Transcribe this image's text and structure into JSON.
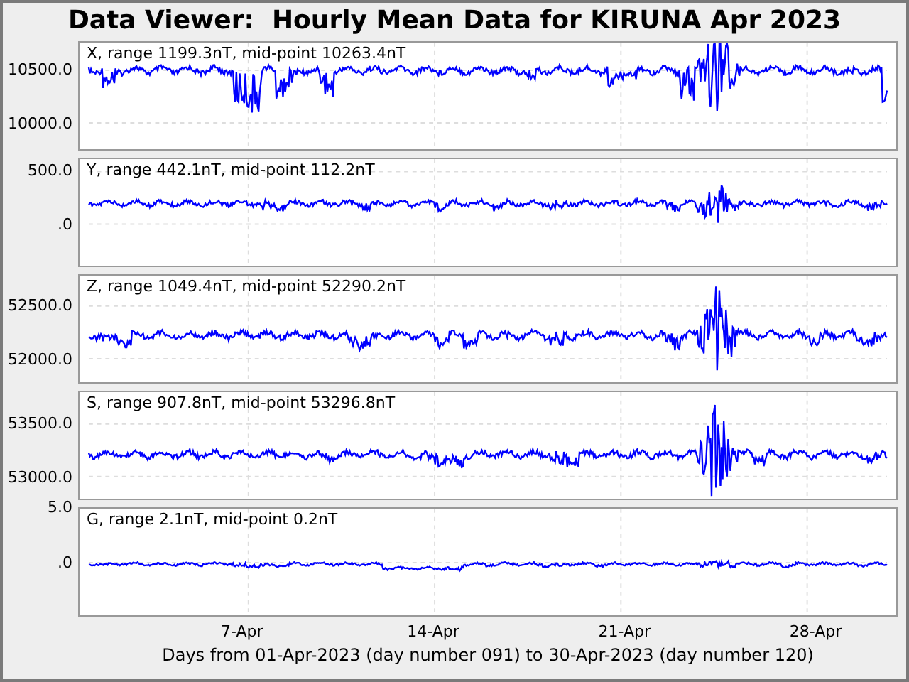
{
  "title": "Data Viewer:  Hourly Mean Data for KIRUNA Apr 2023",
  "panels": [
    {
      "label": "X, range 1199.3nT, mid-point 10263.4nT",
      "ticks": [
        "10500.0",
        "10000.0"
      ]
    },
    {
      "label": "Y, range 442.1nT, mid-point 112.2nT",
      "ticks": [
        "500.0",
        ".0"
      ]
    },
    {
      "label": "Z, range 1049.4nT, mid-point 52290.2nT",
      "ticks": [
        "52500.0",
        "52000.0"
      ]
    },
    {
      "label": "S, range 907.8nT, mid-point 53296.8nT",
      "ticks": [
        "53500.0",
        "53000.0"
      ]
    },
    {
      "label": "G, range 2.1nT, mid-point 0.2nT",
      "ticks": [
        "5.0",
        ".0"
      ]
    }
  ],
  "x_axis": {
    "ticks": [
      "7-Apr",
      "14-Apr",
      "21-Apr",
      "28-Apr"
    ],
    "label": "Days from 01-Apr-2023 (day number 091) to 30-Apr-2023 (day number 120)"
  }
}
